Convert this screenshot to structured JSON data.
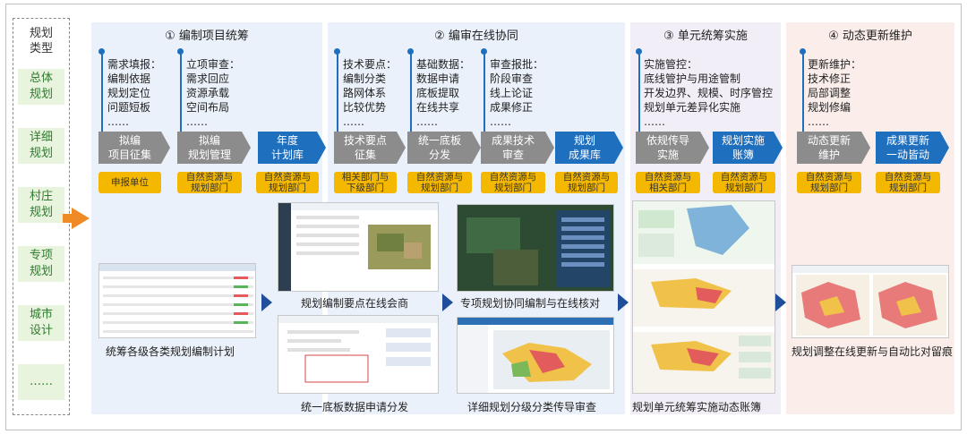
{
  "left": {
    "header": [
      "规划",
      "类型"
    ],
    "types": [
      [
        "总体",
        "规划"
      ],
      [
        "详细",
        "规划"
      ],
      [
        "村庄",
        "规划"
      ],
      [
        "专项",
        "规划"
      ],
      [
        "城市",
        "设计"
      ],
      [
        "……"
      ]
    ]
  },
  "stages": [
    {
      "title": "① 编制项目统筹",
      "color": "#eaf1fa"
    },
    {
      "title": "② 编审在线协同",
      "color": "#eaf1fa"
    },
    {
      "title": "③ 单元统筹实施",
      "color": "#f2eef7"
    },
    {
      "title": "④ 动态更新维护",
      "color": "#fbeeea"
    }
  ],
  "notes": [
    {
      "lines": [
        "需求填报：",
        "编制依据",
        "规划定位",
        "问题短板",
        "……"
      ]
    },
    {
      "lines": [
        "立项审查：",
        "需求回应",
        "资源承载",
        "空间布局",
        "……"
      ]
    },
    {
      "lines": [
        "技术要点：",
        "编制分类",
        "路网体系",
        "比较优势",
        "……"
      ]
    },
    {
      "lines": [
        "基础数据：",
        "数据申请",
        "底板提取",
        "在线共享",
        "……"
      ]
    },
    {
      "lines": [
        "审查报批：",
        "阶段审查",
        "线上论证",
        "成果修正",
        "……"
      ]
    },
    {
      "lines": [
        "实施管控：",
        "底线管护与用途管制",
        "开发边界、规模、时序管控",
        "规划单元差异化实施",
        "……"
      ]
    },
    {
      "lines": [
        "更新维护：",
        "技术修正",
        "局部调整",
        "规划修编",
        "……"
      ]
    }
  ],
  "flow": [
    {
      "label": [
        "拟编",
        "项目征集"
      ],
      "kind": "gray",
      "tag": [
        "申报单位"
      ]
    },
    {
      "label": [
        "拟编",
        "规划管理"
      ],
      "kind": "gray",
      "tag": [
        "自然资源与",
        "规划部门"
      ]
    },
    {
      "label": [
        "年度",
        "计划库"
      ],
      "kind": "blue",
      "tag": [
        "自然资源与",
        "规划部门"
      ]
    },
    {
      "label": [
        "技术要点",
        "征集"
      ],
      "kind": "gray",
      "tag": [
        "相关部门与",
        "下级部门"
      ]
    },
    {
      "label": [
        "统一底板",
        "分发"
      ],
      "kind": "gray",
      "tag": [
        "自然资源与",
        "规划部门"
      ]
    },
    {
      "label": [
        "成果技术",
        "审查"
      ],
      "kind": "gray",
      "tag": [
        "自然资源与",
        "规划部门"
      ]
    },
    {
      "label": [
        "规划",
        "成果库"
      ],
      "kind": "blue",
      "tag": [
        "自然资源与",
        "规划部门"
      ]
    },
    {
      "label": [
        "依规传导",
        "实施"
      ],
      "kind": "gray",
      "tag": [
        "自然资源与",
        "相关部门"
      ]
    },
    {
      "label": [
        "规划实施",
        "账簿"
      ],
      "kind": "blue",
      "tag": [
        "自然资源与",
        "规划部门"
      ]
    },
    {
      "label": [
        "动态更新",
        "维护"
      ],
      "kind": "gray",
      "tag": [
        "自然资源与",
        "规划部门"
      ]
    },
    {
      "label": [
        "成果更新",
        "一动皆动"
      ],
      "kind": "blue",
      "tag": [
        "自然资源与",
        "规划部门"
      ]
    }
  ],
  "captions": {
    "c1": "统筹各级各类规划编制计划",
    "c2": "规划编制要点在线会商",
    "c3": "统一底板数据申请分发",
    "c4": "专项规划协同编制与在线核对",
    "c5": "详细规划分级分类传导审查",
    "c6": "规划单元统筹实施动态账簿",
    "c7": "规划调整在线更新与自动比对留痕"
  },
  "colors": {
    "accent": "#1f6fbf",
    "gray": "#8c8c8c",
    "tag": "#f5b800",
    "arrow": "#f08a24",
    "navy": "#1f4e9a",
    "lefttype": "#e8f4dd"
  }
}
